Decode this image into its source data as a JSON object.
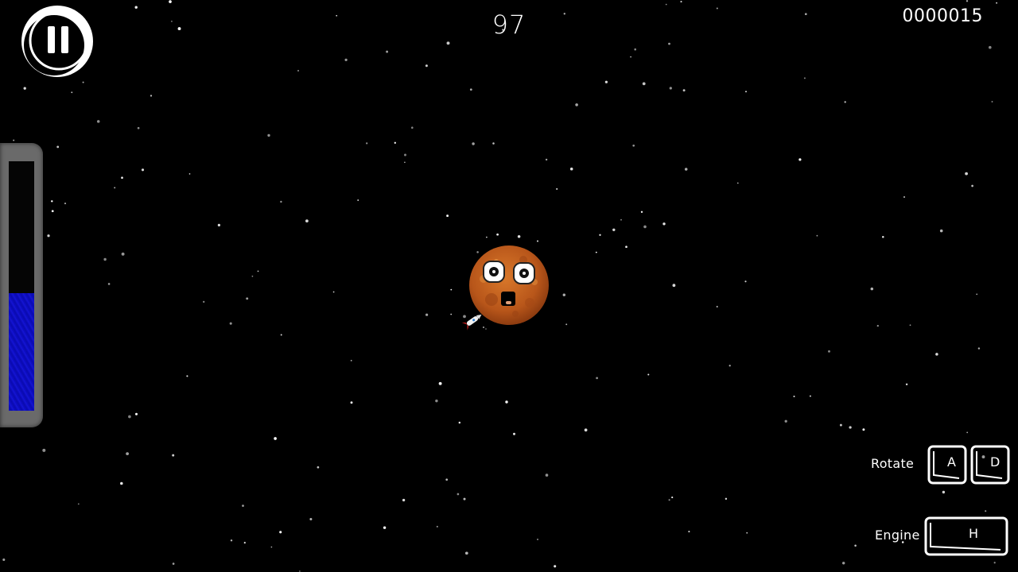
{
  "hud": {
    "timer": "97",
    "score": "0000015",
    "fuel_level": 0.47
  },
  "controls": {
    "rotate_label": "Rotate",
    "rotate_keys": [
      "A",
      "D"
    ],
    "engine_label": "Engine",
    "engine_key": "H"
  },
  "icons": {
    "pause": "pause-icon",
    "planet": "planet-character-icon",
    "rocket": "rocket-icon"
  },
  "colors": {
    "background": "#000000",
    "fuel": "#1010c8",
    "planet": "#c8641e"
  }
}
